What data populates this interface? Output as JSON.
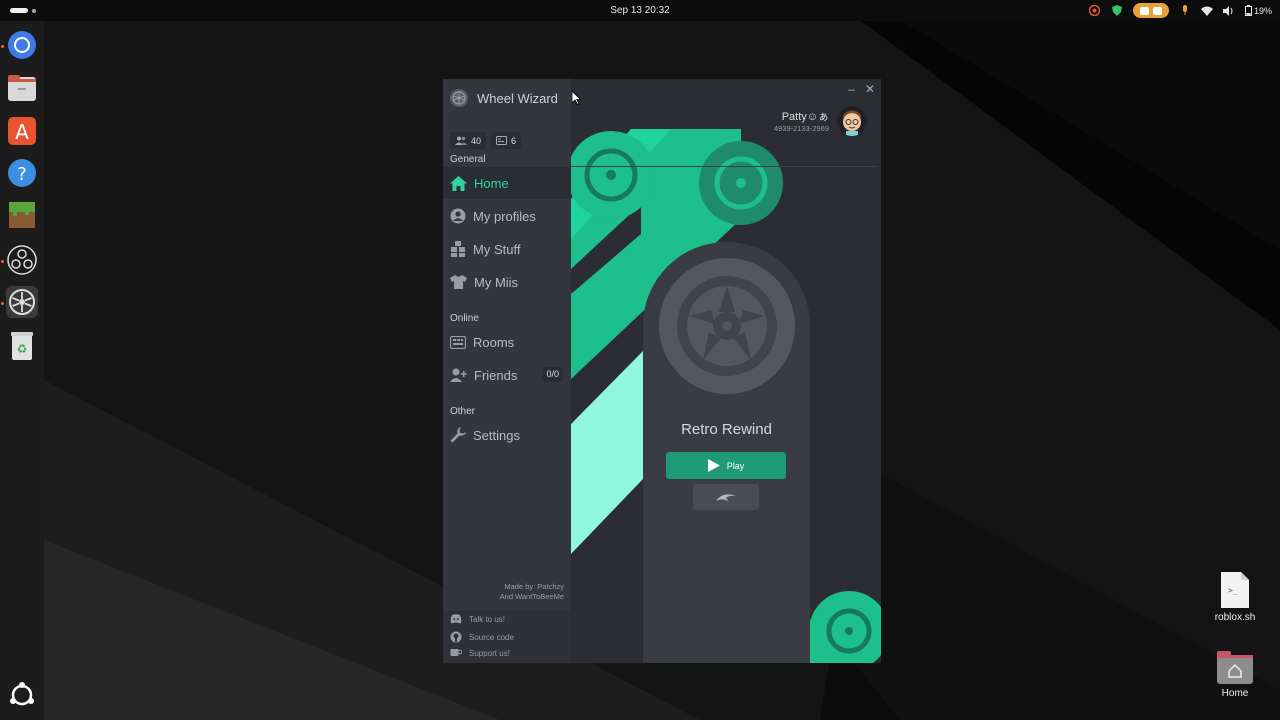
{
  "topbar": {
    "datetime": "Sep 13  20:32",
    "battery": "19%"
  },
  "app": {
    "title": "Wheel Wizard",
    "stats": {
      "players": "40",
      "rooms": "6"
    },
    "sections": {
      "general": "General",
      "online": "Online",
      "other": "Other"
    },
    "nav": {
      "home": "Home",
      "profiles": "My profiles",
      "stuff": "My Stuff",
      "miis": "My Miis",
      "rooms": "Rooms",
      "friends": "Friends",
      "friends_count": "0/0",
      "settings": "Settings"
    },
    "credits": {
      "line1": "Made by: Patchzy",
      "line2": "And WantToBeeMe"
    },
    "footer": {
      "talk": "Talk to us!",
      "source": "Source code",
      "support": "Support us!"
    },
    "profile": {
      "name": "Patty☺ぁ",
      "code": "4939-2133-2969"
    },
    "game": {
      "title": "Retro Rewind",
      "play_label": "Play"
    }
  },
  "desktop": {
    "file_label": "roblox.sh",
    "home_label": "Home"
  },
  "colors": {
    "accent": "#1e9a74",
    "accent_light": "#2bd49b",
    "stripe_light": "#8ff7df"
  }
}
